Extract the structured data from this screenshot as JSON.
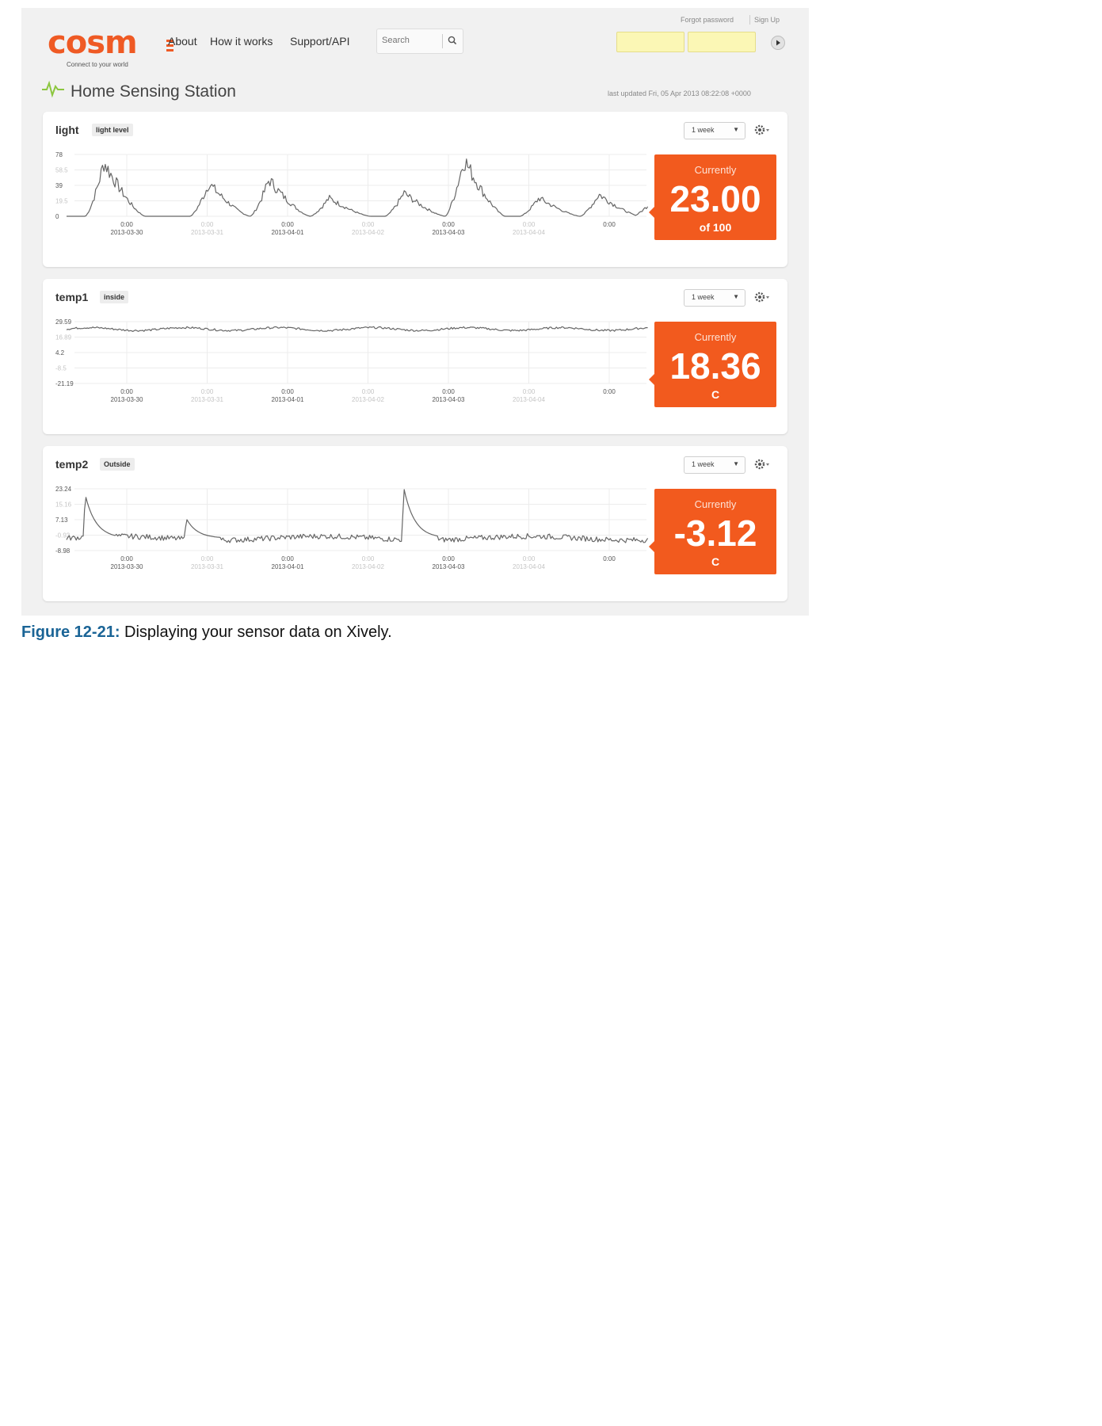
{
  "header": {
    "logo_text": "cosm",
    "logo_tagline": "Connect to your world",
    "nav": [
      "About",
      "How it works",
      "Support/API"
    ],
    "search_placeholder": "Search",
    "forgot_password": "Forgot password",
    "sign_up": "Sign Up"
  },
  "page": {
    "title": "Home Sensing Station",
    "last_updated": "last updated Fri, 05 Apr 2013 08:22:08 +0000"
  },
  "colors": {
    "brand": "#ef5a24",
    "current_box": "#f25a1e",
    "pulse": "#8cc63f",
    "line": "#666666"
  },
  "feeds": [
    {
      "name": "light",
      "tag": "light level",
      "range": "1 week",
      "current_label": "Currently",
      "current_value": "23.00",
      "current_unit": "of 100",
      "chart": {
        "y_ticks": [
          "78",
          "58.5",
          "39",
          "19.5",
          "0"
        ],
        "y_tick_muted": [
          false,
          true,
          false,
          true,
          false
        ],
        "y_range": [
          0,
          78
        ],
        "peaks": [
          [
            0.5,
            74
          ],
          [
            1.9,
            45
          ],
          [
            2.7,
            50
          ],
          [
            3.5,
            25
          ],
          [
            4.5,
            32
          ],
          [
            5.3,
            78
          ],
          [
            6.3,
            25
          ],
          [
            7.1,
            30
          ],
          [
            7.8,
            20
          ]
        ],
        "series_shape": "daily"
      }
    },
    {
      "name": "temp1",
      "tag": "inside",
      "range": "1 week",
      "current_label": "Currently",
      "current_value": "18.36",
      "current_unit": "C",
      "chart": {
        "y_ticks": [
          "29.59",
          "16.89",
          "4.2",
          "-8.5",
          "-21.19"
        ],
        "y_tick_muted": [
          false,
          true,
          false,
          true,
          false
        ],
        "y_range": [
          -21.19,
          29.59
        ],
        "series_shape": "flat",
        "baseline": 23.5
      }
    },
    {
      "name": "temp2",
      "tag": "Outside",
      "range": "1 week",
      "current_label": "Currently",
      "current_value": "-3.12",
      "current_unit": "C",
      "chart": {
        "y_ticks": [
          "23.24",
          "15.16",
          "7.13",
          "-0.93",
          "-8.98"
        ],
        "y_tick_muted": [
          false,
          true,
          false,
          true,
          false
        ],
        "y_range": [
          -8.98,
          23.24
        ],
        "series_shape": "noisy",
        "baseline": -2.5,
        "spikes": [
          [
            0.25,
            20
          ],
          [
            1.6,
            7.5
          ],
          [
            4.5,
            23.24
          ]
        ]
      }
    }
  ],
  "x_axis": [
    {
      "time": "0:00",
      "date": "2013-03-30",
      "muted": false
    },
    {
      "time": "0:00",
      "date": "2013-03-31",
      "muted": true
    },
    {
      "time": "0:00",
      "date": "2013-04-01",
      "muted": false
    },
    {
      "time": "0:00",
      "date": "2013-04-02",
      "muted": true
    },
    {
      "time": "0:00",
      "date": "2013-04-03",
      "muted": false
    },
    {
      "time": "0:00",
      "date": "2013-04-04",
      "muted": true
    },
    {
      "time": "0:00",
      "date": "",
      "muted": false
    }
  ],
  "caption": {
    "number": "Figure 12-21:",
    "text": " Displaying your sensor data on Xively."
  }
}
